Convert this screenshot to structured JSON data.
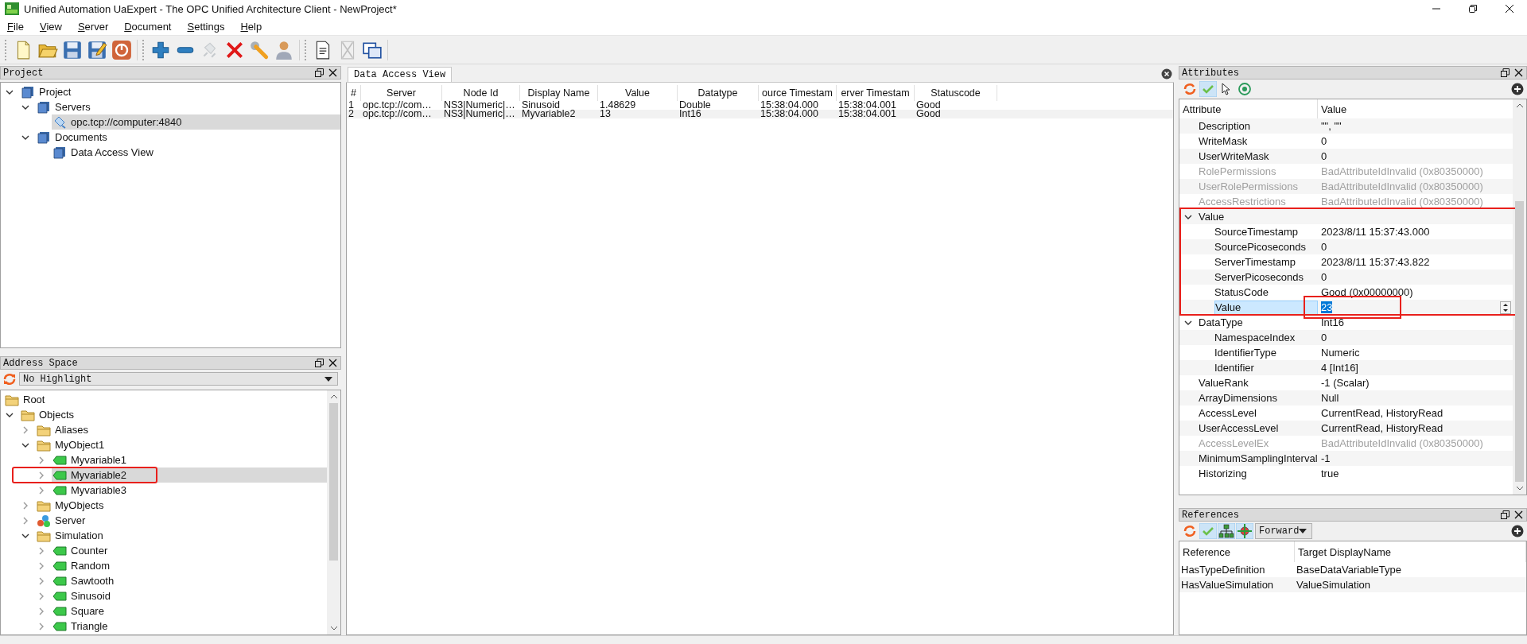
{
  "window": {
    "title": "Unified Automation UaExpert - The OPC Unified Architecture Client - NewProject*"
  },
  "menu": [
    "File",
    "View",
    "Server",
    "Document",
    "Settings",
    "Help"
  ],
  "toolbar": {
    "groups": [
      {
        "buttons": [
          {
            "kind": "new",
            "disabled": false
          },
          {
            "kind": "open",
            "disabled": false
          },
          {
            "kind": "save",
            "disabled": false
          },
          {
            "kind": "edit",
            "disabled": false
          },
          {
            "kind": "power",
            "disabled": false
          }
        ]
      },
      {
        "buttons": [
          {
            "kind": "add",
            "disabled": false
          },
          {
            "kind": "remove",
            "disabled": false
          },
          {
            "kind": "connect",
            "disabled": true
          },
          {
            "kind": "delete",
            "disabled": false
          },
          {
            "kind": "wrench",
            "disabled": false
          },
          {
            "kind": "user",
            "disabled": false
          }
        ]
      },
      {
        "buttons": [
          {
            "kind": "document",
            "disabled": false
          },
          {
            "kind": "close-document",
            "disabled": true
          },
          {
            "kind": "windows",
            "disabled": false
          }
        ]
      }
    ]
  },
  "project": {
    "title": "Project",
    "tree": [
      {
        "label": "Project",
        "kind": "book",
        "expanded": true,
        "selected": false,
        "children": [
          {
            "label": "Servers",
            "kind": "book",
            "expanded": true,
            "selected": false,
            "children": [
              {
                "label": "opc.tcp://computer:4840",
                "kind": "plug",
                "selected": true
              }
            ]
          },
          {
            "label": "Documents",
            "kind": "book",
            "expanded": true,
            "selected": false,
            "children": [
              {
                "label": "Data Access View",
                "kind": "book",
                "selected": false
              }
            ]
          }
        ]
      }
    ]
  },
  "address_space": {
    "title": "Address Space",
    "highlight": "No Highlight",
    "tree": [
      {
        "label": "Root",
        "kind": "folder",
        "selected": false,
        "annotated": false,
        "children": [
          {
            "label": "Objects",
            "kind": "folder",
            "expanded": true,
            "selected": false,
            "annotated": false,
            "children": [
              {
                "label": "Aliases",
                "kind": "folder",
                "expanded": false,
                "selected": false,
                "annotated": false
              },
              {
                "label": "MyObject1",
                "kind": "folder",
                "expanded": true,
                "selected": false,
                "annotated": false,
                "children": [
                  {
                    "label": "Myvariable1",
                    "kind": "variable",
                    "expanded": false,
                    "selected": false,
                    "annotated": false
                  },
                  {
                    "label": "Myvariable2",
                    "kind": "variable",
                    "expanded": false,
                    "selected": true,
                    "annotated": true
                  },
                  {
                    "label": "Myvariable3",
                    "kind": "variable",
                    "expanded": false,
                    "selected": false,
                    "annotated": false
                  }
                ]
              },
              {
                "label": "MyObjects",
                "kind": "folder",
                "expanded": false,
                "selected": false,
                "annotated": false
              },
              {
                "label": "Server",
                "kind": "server",
                "expanded": false,
                "selected": false,
                "annotated": false
              },
              {
                "label": "Simulation",
                "kind": "folder",
                "expanded": true,
                "selected": false,
                "annotated": false,
                "children": [
                  {
                    "label": "Counter",
                    "kind": "variable",
                    "expanded": false,
                    "selected": false,
                    "annotated": false
                  },
                  {
                    "label": "Random",
                    "kind": "variable",
                    "expanded": false,
                    "selected": false,
                    "annotated": false
                  },
                  {
                    "label": "Sawtooth",
                    "kind": "variable",
                    "expanded": false,
                    "selected": false,
                    "annotated": false
                  },
                  {
                    "label": "Sinusoid",
                    "kind": "variable",
                    "expanded": false,
                    "selected": false,
                    "annotated": false
                  },
                  {
                    "label": "Square",
                    "kind": "variable",
                    "expanded": false,
                    "selected": false,
                    "annotated": false
                  },
                  {
                    "label": "Triangle",
                    "kind": "variable",
                    "expanded": false,
                    "selected": false,
                    "annotated": false
                  }
                ]
              }
            ]
          }
        ]
      }
    ]
  },
  "data_access_view": {
    "tab": {
      "label": "Data Access View",
      "selected": true
    },
    "columns": [
      "#",
      "Server",
      "Node Id",
      "Display Name",
      "Value",
      "Datatype",
      "ource Timestam",
      "erver Timestam",
      "Statuscode"
    ],
    "rows": [
      [
        "1",
        "opc.tcp://com…",
        "NS3|Numeric|…",
        "Sinusoid",
        "1.48629",
        "Double",
        "15:38:04.000",
        "15:38:04.001",
        "Good"
      ],
      [
        "2",
        "opc.tcp://com…",
        "NS3|Numeric|…",
        "Myvariable2",
        "13",
        "Int16",
        "15:38:04.000",
        "15:38:04.001",
        "Good"
      ]
    ]
  },
  "attributes": {
    "title": "Attributes",
    "toolbar": [
      {
        "kind": "refresh",
        "pressed": false
      },
      {
        "kind": "check",
        "pressed": true
      },
      {
        "kind": "cursor",
        "pressed": false
      },
      {
        "kind": "target",
        "pressed": false
      }
    ],
    "columns": [
      "Attribute",
      "Value"
    ],
    "rows": [
      {
        "label": "Description",
        "value": "\"\", \"\"",
        "disabled": false,
        "selected": false,
        "annotated": false
      },
      {
        "label": "WriteMask",
        "value": "0",
        "disabled": false,
        "selected": false,
        "annotated": false
      },
      {
        "label": "UserWriteMask",
        "value": "0",
        "disabled": false,
        "selected": false,
        "annotated": false
      },
      {
        "label": "RolePermissions",
        "value": "BadAttributeIdInvalid (0x80350000)",
        "disabled": true,
        "selected": false,
        "annotated": false
      },
      {
        "label": "UserRolePermissions",
        "value": "BadAttributeIdInvalid (0x80350000)",
        "disabled": true,
        "selected": false,
        "annotated": false
      },
      {
        "label": "AccessRestrictions",
        "value": "BadAttributeIdInvalid (0x80350000)",
        "disabled": true,
        "selected": false,
        "annotated": false
      },
      {
        "label": "Value",
        "expanded": true,
        "disabled": false,
        "selected": false,
        "annotated": true,
        "children": [
          {
            "label": "SourceTimestamp",
            "value": "2023/8/11 15:37:43.000",
            "disabled": false,
            "selected": false,
            "annotated": false
          },
          {
            "label": "SourcePicoseconds",
            "value": "0",
            "disabled": false,
            "selected": false,
            "annotated": false
          },
          {
            "label": "ServerTimestamp",
            "value": "2023/8/11 15:37:43.822",
            "disabled": false,
            "selected": false,
            "annotated": false
          },
          {
            "label": "ServerPicoseconds",
            "value": "0",
            "disabled": false,
            "selected": false,
            "annotated": false
          },
          {
            "label": "StatusCode",
            "value": "Good (0x00000000)",
            "disabled": false,
            "selected": false,
            "annotated": false
          },
          {
            "label": "Value",
            "value": "23",
            "disabled": false,
            "selected": true,
            "annotated": true
          }
        ]
      },
      {
        "label": "DataType",
        "value": "Int16",
        "expanded": true,
        "disabled": false,
        "selected": false,
        "annotated": false,
        "children": [
          {
            "label": "NamespaceIndex",
            "value": "0",
            "disabled": false,
            "selected": false,
            "annotated": false
          },
          {
            "label": "IdentifierType",
            "value": "Numeric",
            "disabled": false,
            "selected": false,
            "annotated": false
          },
          {
            "label": "Identifier",
            "value": "4 [Int16]",
            "disabled": false,
            "selected": false,
            "annotated": false
          }
        ]
      },
      {
        "label": "ValueRank",
        "value": "-1 (Scalar)",
        "disabled": false,
        "selected": false,
        "annotated": false
      },
      {
        "label": "ArrayDimensions",
        "value": "Null",
        "disabled": false,
        "selected": false,
        "annotated": false
      },
      {
        "label": "AccessLevel",
        "value": "CurrentRead, HistoryRead",
        "disabled": false,
        "selected": false,
        "annotated": false
      },
      {
        "label": "UserAccessLevel",
        "value": "CurrentRead, HistoryRead",
        "disabled": false,
        "selected": false,
        "annotated": false
      },
      {
        "label": "AccessLevelEx",
        "value": "BadAttributeIdInvalid (0x80350000)",
        "disabled": true,
        "selected": false,
        "annotated": false
      },
      {
        "label": "MinimumSamplingInterval",
        "value": "-1",
        "disabled": false,
        "selected": false,
        "annotated": false
      },
      {
        "label": "Historizing",
        "value": "true",
        "disabled": false,
        "selected": false,
        "annotated": false
      }
    ]
  },
  "references": {
    "title": "References",
    "toolbar": [
      {
        "kind": "refresh",
        "pressed": false
      },
      {
        "kind": "check",
        "pressed": true
      },
      {
        "kind": "hierarchy",
        "pressed": true
      },
      {
        "kind": "move",
        "pressed": true
      }
    ],
    "direction": "Forward",
    "columns": [
      "Reference",
      "Target DisplayName"
    ],
    "rows": [
      [
        "HasTypeDefinition",
        "BaseDataVariableType"
      ],
      [
        "HasValueSimulation",
        "ValueSimulation"
      ]
    ]
  }
}
